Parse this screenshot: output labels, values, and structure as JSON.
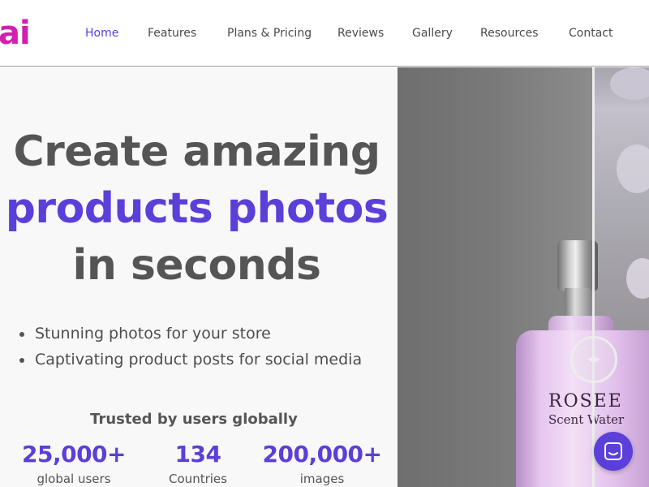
{
  "brand": {
    "logo_text": "ai"
  },
  "nav": {
    "items": [
      {
        "label": "Home",
        "active": true
      },
      {
        "label": "Features",
        "active": false
      },
      {
        "label": "Plans & Pricing",
        "active": false
      },
      {
        "label": "Reviews",
        "active": false
      },
      {
        "label": "Gallery",
        "active": false
      },
      {
        "label": "Resources",
        "active": false
      },
      {
        "label": "Contact",
        "active": false
      }
    ]
  },
  "hero": {
    "headline_line1": "Create amazing",
    "headline_line2": "products photos",
    "headline_line3": "in seconds",
    "bullets": [
      "Stunning photos for your store",
      "Captivating product posts for social media"
    ],
    "trusted_label": "Trusted by users globally",
    "stats": [
      {
        "value": "25,000+",
        "label": "global users"
      },
      {
        "value": "134",
        "label": "Countries"
      },
      {
        "value": "200,000+",
        "label": "images"
      }
    ]
  },
  "product_image": {
    "brand_text": "ROSEE",
    "sub_text": "Scent Water"
  },
  "colors": {
    "accent": "#5b3fd9",
    "logo": "#d41fb0",
    "text": "#555555"
  },
  "icons": {
    "slider_handle": "left-right-arrows-icon",
    "chat": "chat-bubble-icon"
  }
}
